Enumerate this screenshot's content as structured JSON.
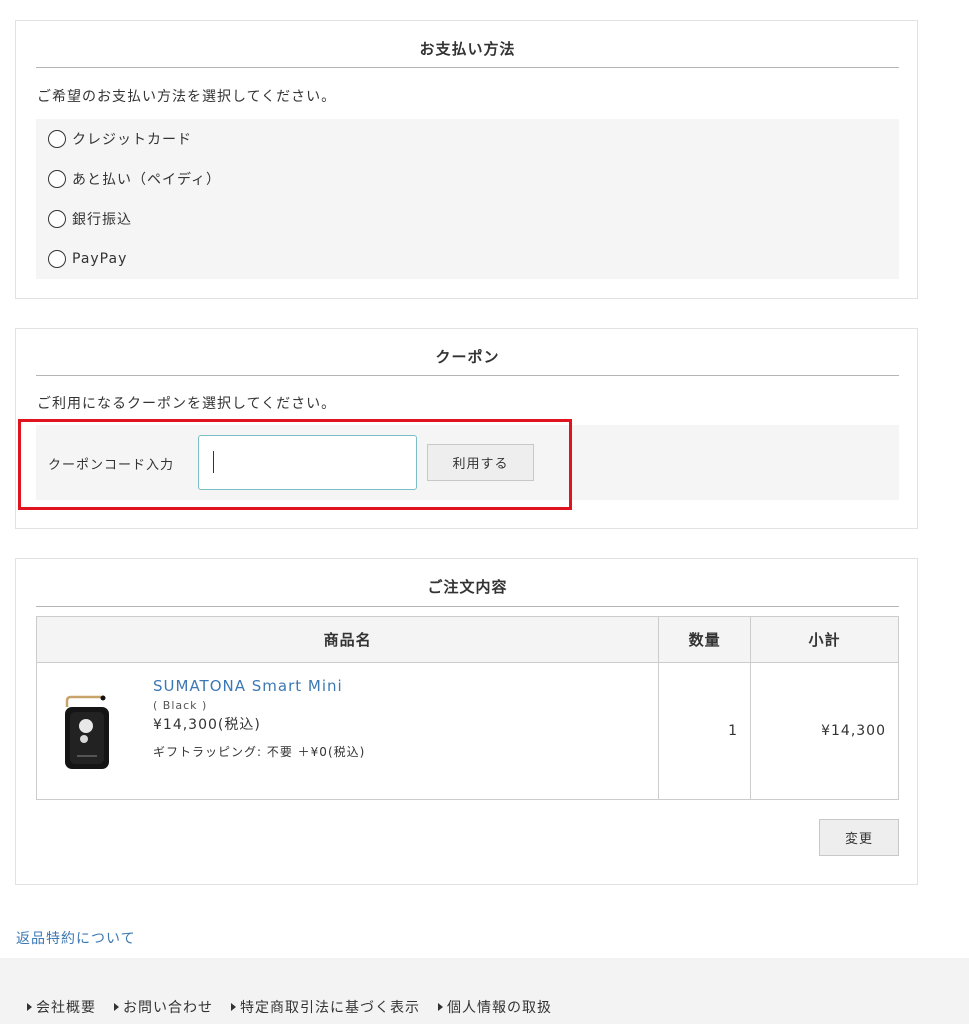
{
  "payment": {
    "title": "お支払い方法",
    "description": "ご希望のお支払い方法を選択してください。",
    "options": [
      {
        "label": "クレジットカード"
      },
      {
        "label": "あと払い（ペイディ）"
      },
      {
        "label": "銀行振込"
      },
      {
        "label": "PayPay"
      }
    ]
  },
  "coupon": {
    "title": "クーポン",
    "description": "ご利用になるクーポンを選択してください。",
    "code_label": "クーポンコード入力",
    "input_value": "",
    "apply_label": "利用する"
  },
  "order": {
    "title": "ご注文内容",
    "headers": {
      "name": "商品名",
      "qty": "数量",
      "subtotal": "小計"
    },
    "items": [
      {
        "name": "SUMATONA Smart Mini",
        "variant": "( Black )",
        "price": "¥14,300(税込)",
        "gift": "ギフトラッピング: 不要 ＋¥0(税込)",
        "qty": "1",
        "subtotal": "¥14,300",
        "image_icon": "product-device-icon"
      }
    ],
    "change_label": "変更"
  },
  "return_link": "返品特約について",
  "footer": {
    "links": [
      {
        "label": "会社概要"
      },
      {
        "label": "お問い合わせ"
      },
      {
        "label": "特定商取引法に基づく表示"
      },
      {
        "label": "個人情報の取扱"
      }
    ]
  },
  "colors": {
    "link": "#3c78b4",
    "highlight": "#e0141e",
    "input_border": "#7bbdc8",
    "box_bg": "#f5f5f5"
  }
}
